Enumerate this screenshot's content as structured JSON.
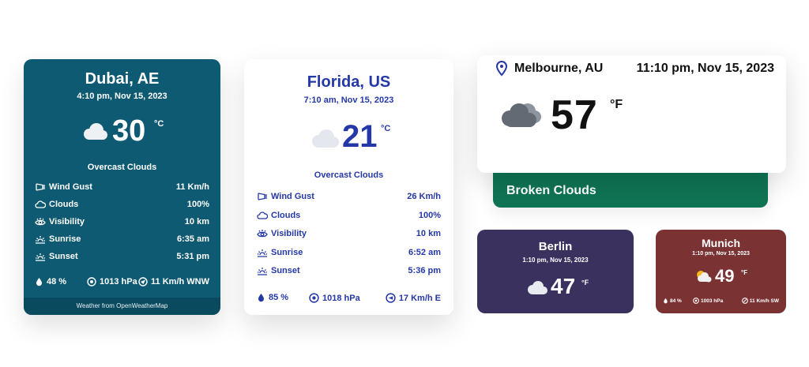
{
  "dubai": {
    "city": "Dubai, AE",
    "datetime": "4:10 pm, Nov 15, 2023",
    "temp": "30",
    "unit": "°C",
    "description": "Overcast Clouds",
    "details": [
      {
        "icon": "wind-icon",
        "label": "Wind Gust",
        "value": "11 Km/h"
      },
      {
        "icon": "cloud-icon",
        "label": "Clouds",
        "value": "100%"
      },
      {
        "icon": "eye-icon",
        "label": "Visibility",
        "value": "10 km"
      },
      {
        "icon": "sunrise-icon",
        "label": "Sunrise",
        "value": "6:35 am"
      },
      {
        "icon": "sunset-icon",
        "label": "Sunset",
        "value": "5:31 pm"
      }
    ],
    "humidity": "48 %",
    "pressure": "1013 hPa",
    "wind": "11 Km/h WNW",
    "footer": "Weather from OpenWeatherMap",
    "colors": {
      "bg": "#0e5a72",
      "text": "#ffffff"
    }
  },
  "florida": {
    "city": "Florida, US",
    "datetime": "7:10 am, Nov 15, 2023",
    "temp": "21",
    "unit": "°C",
    "description": "Overcast Clouds",
    "details": [
      {
        "icon": "wind-icon",
        "label": "Wind Gust",
        "value": "26 Km/h"
      },
      {
        "icon": "cloud-icon",
        "label": "Clouds",
        "value": "100%"
      },
      {
        "icon": "eye-icon",
        "label": "Visibility",
        "value": "10 km"
      },
      {
        "icon": "sunrise-icon",
        "label": "Sunrise",
        "value": "6:52 am"
      },
      {
        "icon": "sunset-icon",
        "label": "Sunset",
        "value": "5:36 pm"
      }
    ],
    "humidity": "85 %",
    "pressure": "1018 hPa",
    "wind": "17 Km/h E",
    "colors": {
      "bg": "#ffffff",
      "text": "#2438a8"
    }
  },
  "melbourne": {
    "city": "Melbourne, AU",
    "datetime": "11:10 pm, Nov 15, 2023",
    "temp": "57",
    "unit": "°F",
    "description": "Broken Clouds",
    "colors": {
      "bg": "#ffffff",
      "accent": "#0f7454"
    }
  },
  "berlin": {
    "city": "Berlin",
    "datetime": "1:10 pm, Nov 15, 2023",
    "temp": "47",
    "unit": "°F",
    "colors": {
      "bg": "#3a315f"
    }
  },
  "munich": {
    "city": "Munich",
    "datetime": "1:10 pm, Nov 15, 2023",
    "temp": "49",
    "unit": "°F",
    "humidity": "84 %",
    "pressure": "1003 hPa",
    "wind": "11 Km/h SW",
    "colors": {
      "bg": "#7b3233"
    }
  }
}
